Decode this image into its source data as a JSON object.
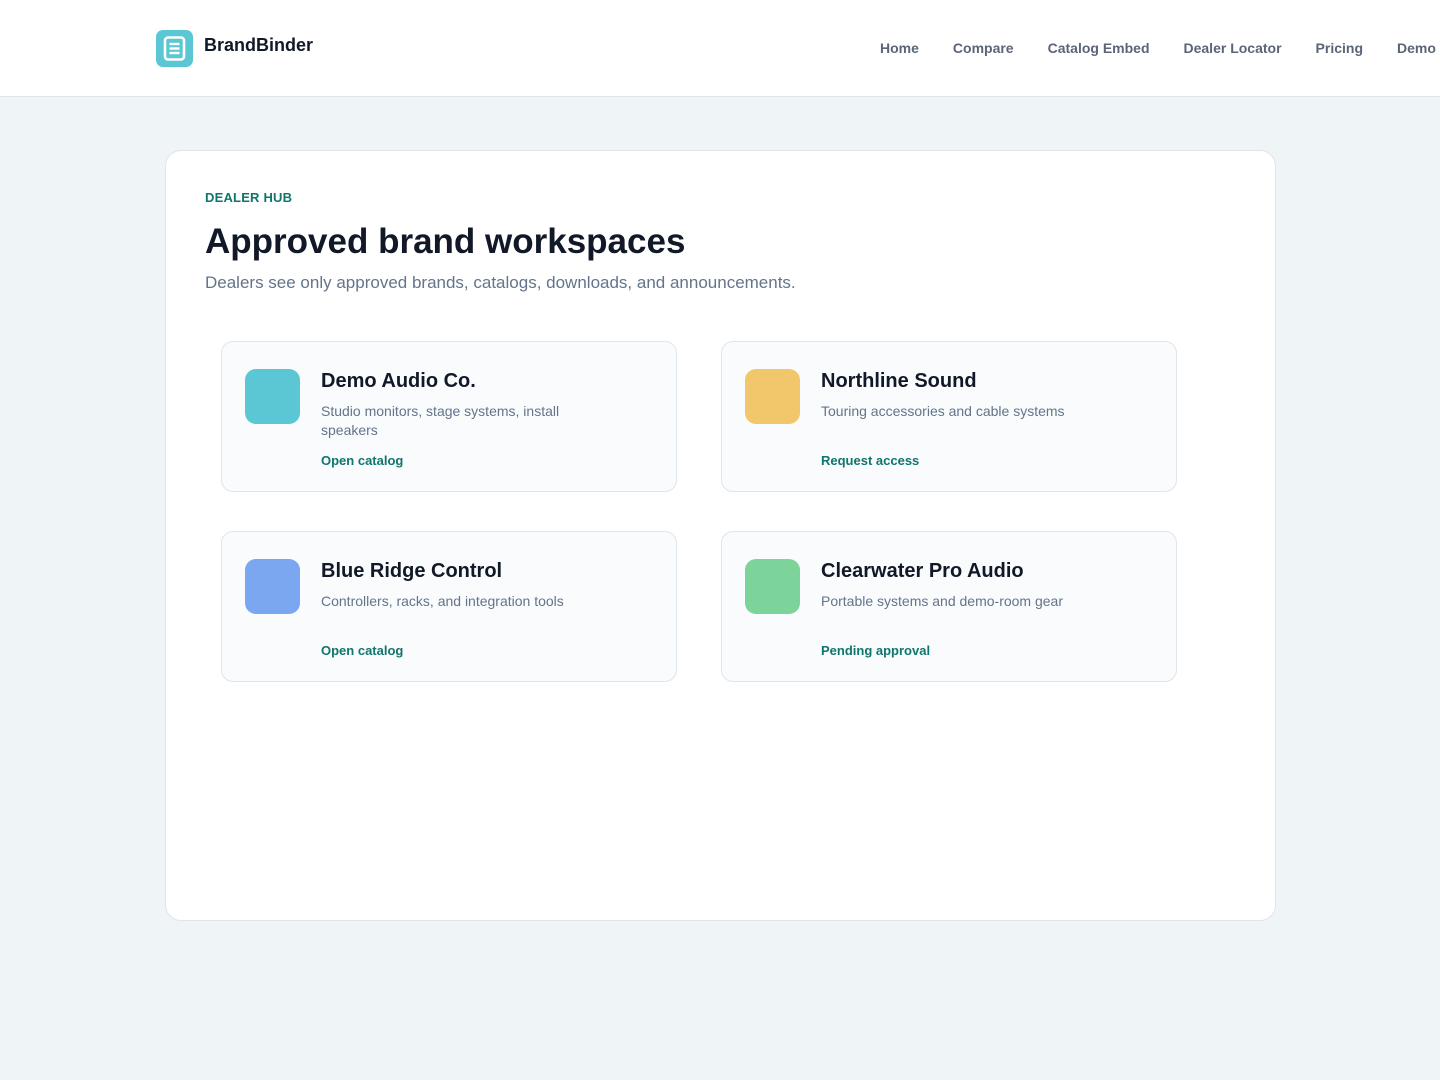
{
  "brand": {
    "name": "BrandBinder",
    "logo_icon": "binder-icon",
    "logo_color": "#5bc6d4"
  },
  "nav": {
    "items": [
      "Home",
      "Compare",
      "Catalog Embed",
      "Dealer Locator",
      "Pricing",
      "Demo"
    ]
  },
  "hub": {
    "eyebrow": "DEALER HUB",
    "title": "Approved brand workspaces",
    "subtitle": "Dealers see only approved brands, catalogs, downloads, and announcements."
  },
  "brands": [
    {
      "name": "Demo Audio Co.",
      "description": "Studio monitors, stage systems, install speakers",
      "action": "Open catalog",
      "color": "#5bc6d4"
    },
    {
      "name": "Northline Sound",
      "description": "Touring accessories and cable systems",
      "action": "Request access",
      "color": "#f2c66b"
    },
    {
      "name": "Blue Ridge Control",
      "description": "Controllers, racks, and integration tools",
      "action": "Open catalog",
      "color": "#7ba7f0"
    },
    {
      "name": "Clearwater Pro Audio",
      "description": "Portable systems and demo-room gear",
      "action": "Pending approval",
      "color": "#7dd49a"
    }
  ],
  "colors": {
    "accent": "#0f766e",
    "background": "#eff4f7"
  }
}
